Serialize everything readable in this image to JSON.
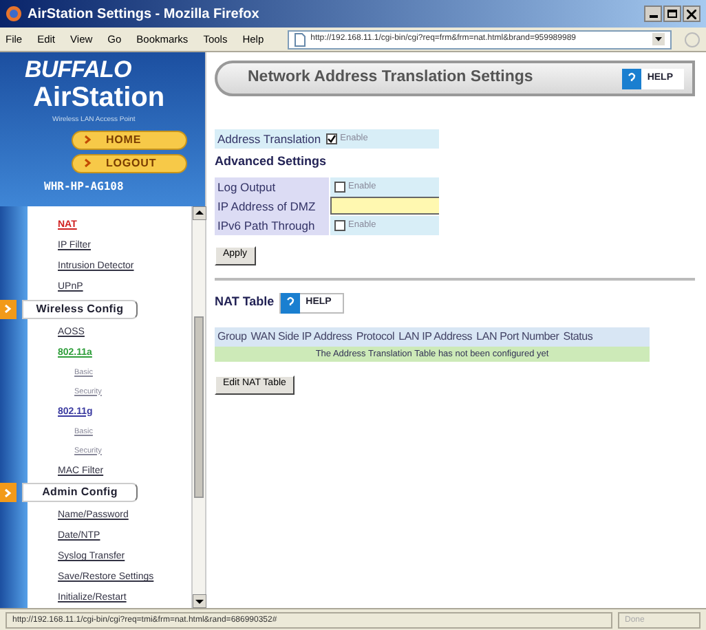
{
  "window": {
    "title": "AirStation Settings - Mozilla Firefox"
  },
  "menu": [
    "File",
    "Edit",
    "View",
    "Go",
    "Bookmarks",
    "Tools",
    "Help"
  ],
  "address": {
    "value": "http://192.168.11.1/cgi-bin/cgi?req=frm&frm=nat.html&brand=959989989"
  },
  "sidebar": {
    "brand": "BUFFALO",
    "product": "AirStation",
    "tagline": "Wireless LAN Access Point",
    "buttons": [
      "HOME",
      "LOGOUT"
    ],
    "model": "WHR-HP-AG108",
    "items": [
      {
        "kind": "link",
        "label": "NAT",
        "selected": true
      },
      {
        "kind": "link",
        "label": "IP Filter",
        "selected": false
      },
      {
        "kind": "link",
        "label": "Intrusion Detector",
        "selected": false
      },
      {
        "kind": "link",
        "label": "UPnP",
        "selected": false
      },
      {
        "kind": "section",
        "label": "Wireless Config",
        "selected": false
      },
      {
        "kind": "link",
        "label": "AOSS",
        "selected": false
      },
      {
        "kind": "group",
        "label": "802.11a",
        "selected": false,
        "color": "#2e9e3a"
      },
      {
        "kind": "sublink",
        "label": "Basic",
        "selected": false
      },
      {
        "kind": "sublink",
        "label": "Security",
        "selected": false
      },
      {
        "kind": "group",
        "label": "802.11g",
        "selected": false,
        "color": "#3a3aa0"
      },
      {
        "kind": "sublink",
        "label": "Basic",
        "selected": false
      },
      {
        "kind": "sublink",
        "label": "Security",
        "selected": false
      },
      {
        "kind": "link",
        "label": "MAC Filter",
        "selected": false
      },
      {
        "kind": "section",
        "label": "Admin Config",
        "selected": false
      },
      {
        "kind": "link",
        "label": "Name/Password",
        "selected": false
      },
      {
        "kind": "link",
        "label": "Date/NTP",
        "selected": false
      },
      {
        "kind": "link",
        "label": "Syslog Transfer",
        "selected": false
      },
      {
        "kind": "link",
        "label": "Save/Restore Settings",
        "selected": false
      },
      {
        "kind": "link",
        "label": "Initialize/Restart",
        "selected": false
      }
    ]
  },
  "main": {
    "title": "Network Address Translation Settings",
    "help": "HELP",
    "address_translation": {
      "label": "Address Translation",
      "checked": true,
      "option": "Enable"
    },
    "advanced_heading": "Advanced Settings",
    "advanced": [
      {
        "kind": "checkbox",
        "label": "Log Output",
        "checked": false,
        "option": "Enable"
      },
      {
        "kind": "text",
        "label": "IP Address of DMZ"
      },
      {
        "kind": "checkbox",
        "label": "IPv6 Path Through",
        "checked": false,
        "option": "Enable"
      }
    ],
    "apply": "Apply",
    "nat_table": {
      "title": "NAT Table",
      "help": "HELP",
      "columns": [
        "Group",
        "WAN Side IP Address",
        "Protocol",
        "LAN IP Address",
        "LAN Port Number",
        "Status"
      ],
      "message": "The Address Translation Table has not been configured yet",
      "edit": "Edit NAT Table"
    }
  },
  "status_bar": {
    "url": "http://192.168.11.1/cgi-bin/cgi?req=tmi&frm=nat.html&rand=686990352#",
    "state": "Done"
  }
}
